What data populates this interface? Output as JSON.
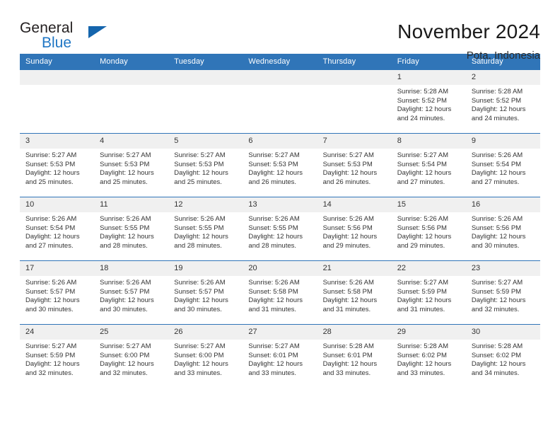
{
  "logo": {
    "word_general": "General",
    "word_blue": "Blue",
    "triangle_color": "#1565ad",
    "blue_color": "#1f76c4"
  },
  "header": {
    "title": "November 2024",
    "location": "Pota, Indonesia"
  },
  "theme": {
    "header_blue": "#3075b8",
    "daynum_band": "#f0f0f0",
    "text": "#333333"
  },
  "weekday_headers": [
    "Sunday",
    "Monday",
    "Tuesday",
    "Wednesday",
    "Thursday",
    "Friday",
    "Saturday"
  ],
  "weeks": [
    [
      {
        "empty": true
      },
      {
        "empty": true
      },
      {
        "empty": true
      },
      {
        "empty": true
      },
      {
        "empty": true
      },
      {
        "day": "1",
        "sunrise": "Sunrise: 5:28 AM",
        "sunset": "Sunset: 5:52 PM",
        "daylight1": "Daylight: 12 hours",
        "daylight2": "and 24 minutes."
      },
      {
        "day": "2",
        "sunrise": "Sunrise: 5:28 AM",
        "sunset": "Sunset: 5:52 PM",
        "daylight1": "Daylight: 12 hours",
        "daylight2": "and 24 minutes."
      }
    ],
    [
      {
        "day": "3",
        "sunrise": "Sunrise: 5:27 AM",
        "sunset": "Sunset: 5:53 PM",
        "daylight1": "Daylight: 12 hours",
        "daylight2": "and 25 minutes."
      },
      {
        "day": "4",
        "sunrise": "Sunrise: 5:27 AM",
        "sunset": "Sunset: 5:53 PM",
        "daylight1": "Daylight: 12 hours",
        "daylight2": "and 25 minutes."
      },
      {
        "day": "5",
        "sunrise": "Sunrise: 5:27 AM",
        "sunset": "Sunset: 5:53 PM",
        "daylight1": "Daylight: 12 hours",
        "daylight2": "and 25 minutes."
      },
      {
        "day": "6",
        "sunrise": "Sunrise: 5:27 AM",
        "sunset": "Sunset: 5:53 PM",
        "daylight1": "Daylight: 12 hours",
        "daylight2": "and 26 minutes."
      },
      {
        "day": "7",
        "sunrise": "Sunrise: 5:27 AM",
        "sunset": "Sunset: 5:53 PM",
        "daylight1": "Daylight: 12 hours",
        "daylight2": "and 26 minutes."
      },
      {
        "day": "8",
        "sunrise": "Sunrise: 5:27 AM",
        "sunset": "Sunset: 5:54 PM",
        "daylight1": "Daylight: 12 hours",
        "daylight2": "and 27 minutes."
      },
      {
        "day": "9",
        "sunrise": "Sunrise: 5:26 AM",
        "sunset": "Sunset: 5:54 PM",
        "daylight1": "Daylight: 12 hours",
        "daylight2": "and 27 minutes."
      }
    ],
    [
      {
        "day": "10",
        "sunrise": "Sunrise: 5:26 AM",
        "sunset": "Sunset: 5:54 PM",
        "daylight1": "Daylight: 12 hours",
        "daylight2": "and 27 minutes."
      },
      {
        "day": "11",
        "sunrise": "Sunrise: 5:26 AM",
        "sunset": "Sunset: 5:55 PM",
        "daylight1": "Daylight: 12 hours",
        "daylight2": "and 28 minutes."
      },
      {
        "day": "12",
        "sunrise": "Sunrise: 5:26 AM",
        "sunset": "Sunset: 5:55 PM",
        "daylight1": "Daylight: 12 hours",
        "daylight2": "and 28 minutes."
      },
      {
        "day": "13",
        "sunrise": "Sunrise: 5:26 AM",
        "sunset": "Sunset: 5:55 PM",
        "daylight1": "Daylight: 12 hours",
        "daylight2": "and 28 minutes."
      },
      {
        "day": "14",
        "sunrise": "Sunrise: 5:26 AM",
        "sunset": "Sunset: 5:56 PM",
        "daylight1": "Daylight: 12 hours",
        "daylight2": "and 29 minutes."
      },
      {
        "day": "15",
        "sunrise": "Sunrise: 5:26 AM",
        "sunset": "Sunset: 5:56 PM",
        "daylight1": "Daylight: 12 hours",
        "daylight2": "and 29 minutes."
      },
      {
        "day": "16",
        "sunrise": "Sunrise: 5:26 AM",
        "sunset": "Sunset: 5:56 PM",
        "daylight1": "Daylight: 12 hours",
        "daylight2": "and 30 minutes."
      }
    ],
    [
      {
        "day": "17",
        "sunrise": "Sunrise: 5:26 AM",
        "sunset": "Sunset: 5:57 PM",
        "daylight1": "Daylight: 12 hours",
        "daylight2": "and 30 minutes."
      },
      {
        "day": "18",
        "sunrise": "Sunrise: 5:26 AM",
        "sunset": "Sunset: 5:57 PM",
        "daylight1": "Daylight: 12 hours",
        "daylight2": "and 30 minutes."
      },
      {
        "day": "19",
        "sunrise": "Sunrise: 5:26 AM",
        "sunset": "Sunset: 5:57 PM",
        "daylight1": "Daylight: 12 hours",
        "daylight2": "and 30 minutes."
      },
      {
        "day": "20",
        "sunrise": "Sunrise: 5:26 AM",
        "sunset": "Sunset: 5:58 PM",
        "daylight1": "Daylight: 12 hours",
        "daylight2": "and 31 minutes."
      },
      {
        "day": "21",
        "sunrise": "Sunrise: 5:26 AM",
        "sunset": "Sunset: 5:58 PM",
        "daylight1": "Daylight: 12 hours",
        "daylight2": "and 31 minutes."
      },
      {
        "day": "22",
        "sunrise": "Sunrise: 5:27 AM",
        "sunset": "Sunset: 5:59 PM",
        "daylight1": "Daylight: 12 hours",
        "daylight2": "and 31 minutes."
      },
      {
        "day": "23",
        "sunrise": "Sunrise: 5:27 AM",
        "sunset": "Sunset: 5:59 PM",
        "daylight1": "Daylight: 12 hours",
        "daylight2": "and 32 minutes."
      }
    ],
    [
      {
        "day": "24",
        "sunrise": "Sunrise: 5:27 AM",
        "sunset": "Sunset: 5:59 PM",
        "daylight1": "Daylight: 12 hours",
        "daylight2": "and 32 minutes."
      },
      {
        "day": "25",
        "sunrise": "Sunrise: 5:27 AM",
        "sunset": "Sunset: 6:00 PM",
        "daylight1": "Daylight: 12 hours",
        "daylight2": "and 32 minutes."
      },
      {
        "day": "26",
        "sunrise": "Sunrise: 5:27 AM",
        "sunset": "Sunset: 6:00 PM",
        "daylight1": "Daylight: 12 hours",
        "daylight2": "and 33 minutes."
      },
      {
        "day": "27",
        "sunrise": "Sunrise: 5:27 AM",
        "sunset": "Sunset: 6:01 PM",
        "daylight1": "Daylight: 12 hours",
        "daylight2": "and 33 minutes."
      },
      {
        "day": "28",
        "sunrise": "Sunrise: 5:28 AM",
        "sunset": "Sunset: 6:01 PM",
        "daylight1": "Daylight: 12 hours",
        "daylight2": "and 33 minutes."
      },
      {
        "day": "29",
        "sunrise": "Sunrise: 5:28 AM",
        "sunset": "Sunset: 6:02 PM",
        "daylight1": "Daylight: 12 hours",
        "daylight2": "and 33 minutes."
      },
      {
        "day": "30",
        "sunrise": "Sunrise: 5:28 AM",
        "sunset": "Sunset: 6:02 PM",
        "daylight1": "Daylight: 12 hours",
        "daylight2": "and 34 minutes."
      }
    ]
  ]
}
